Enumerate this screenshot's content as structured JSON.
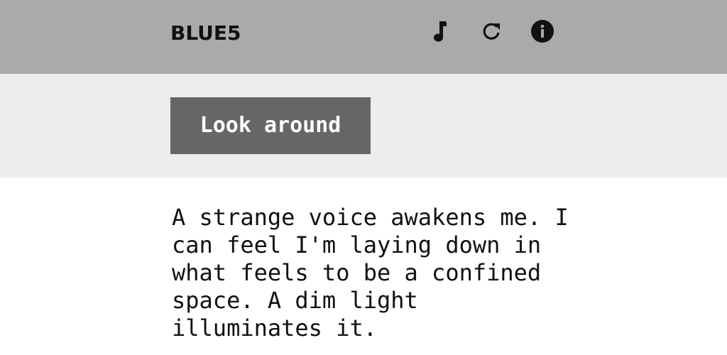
{
  "header": {
    "brand": "BLUE5",
    "icons": [
      {
        "name": "music-note-icon"
      },
      {
        "name": "refresh-icon"
      },
      {
        "name": "info-icon"
      }
    ],
    "background": "#aaaaaa"
  },
  "actions": {
    "primary_label": "Look around",
    "band_background": "#ededed",
    "button_color": "#666666"
  },
  "story": {
    "text": "A strange voice awakens me. I can feel I'm laying down in what feels to be a confined space. A dim light illuminates it."
  }
}
